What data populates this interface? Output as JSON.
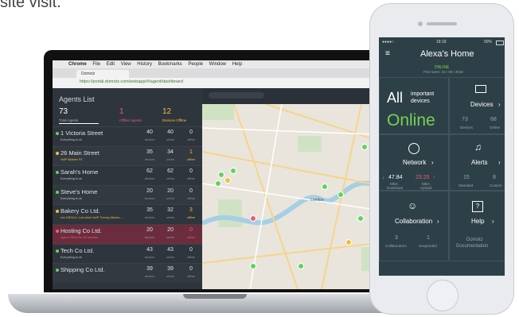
{
  "caption_fragment": "site visit.",
  "laptop": {
    "menu": {
      "app": "Chrome",
      "items": [
        "File",
        "Edit",
        "View",
        "History",
        "Bookmarks",
        "People",
        "Window",
        "Help"
      ]
    },
    "tab": "Domotz",
    "url": "https://portal.domotz.com/webapp/#/agent/dashboard",
    "title": "Agents List",
    "stats": [
      {
        "value": "73",
        "label": "Total Agents",
        "color": "#ffffff"
      },
      {
        "value": "1",
        "label": "Offline Agents",
        "color": "#ef5b7a"
      },
      {
        "value": "12",
        "label": "Devices Offline",
        "color": "#e8c23c"
      }
    ],
    "agents": [
      {
        "name": "1 Victoria Street",
        "sub": "Everything is ok",
        "dot": "#5fd35d",
        "devices": "40",
        "online": "40",
        "offline": "0",
        "offline_color": "#dfe3e7"
      },
      {
        "name": "26 Main Street",
        "sub": "VoIP Kitchen FX",
        "dot": "#f0c03a",
        "devices": "35",
        "online": "34",
        "offline": "1",
        "offline_color": "#f0c03a"
      },
      {
        "name": "Sarah's Home",
        "sub": "Everything is ok",
        "dot": "#5fd35d",
        "devices": "62",
        "online": "62",
        "offline": "0",
        "offline_color": "#dfe3e7"
      },
      {
        "name": "Steve's Home",
        "sub": "Everything is ok",
        "dot": "#5fd35d",
        "devices": "20",
        "online": "20",
        "offline": "0",
        "offline_color": "#dfe3e7"
      },
      {
        "name": "Bakery Co Ltd.",
        "sub": "cnx DSDULI, Luis desk VoIP, Tommy Macbo...",
        "dot": "#f0c03a",
        "devices": "35",
        "online": "32",
        "offline": "3",
        "offline_color": "#f0c03a"
      },
      {
        "name": "Hosting Co Ltd.",
        "sub": "Agent Offline for 35 minutes",
        "dot": "#ef5b7a",
        "devices": "20",
        "online": "20",
        "offline": "0",
        "offline_color": "#ef5b7a",
        "alert": true
      },
      {
        "name": "Tech Co Ltd.",
        "sub": "Everything is ok",
        "dot": "#5fd35d",
        "devices": "43",
        "online": "43",
        "offline": "0",
        "offline_color": "#dfe3e7"
      },
      {
        "name": "Shipping Co Ltd.",
        "sub": "",
        "dot": "#5fd35d",
        "devices": "39",
        "online": "39",
        "offline": "0",
        "offline_color": "#dfe3e7"
      }
    ],
    "col_labels": {
      "devices": "devices",
      "online": "online",
      "offline": "offline"
    },
    "map_label": "London"
  },
  "phone": {
    "time": "18:18",
    "battery": "90%",
    "title": "Alexa's Home",
    "status": "ONLINE",
    "first_seen": "First seen: 23 / 08 / 2016",
    "all": "All",
    "important": "important",
    "devices_word": "devices",
    "online": "Online",
    "devices_label": "Devices",
    "devices_count": "73",
    "devices_count_lbl": "Devices",
    "online_count": "68",
    "online_count_lbl": "Online",
    "network_label": "Network",
    "alerts_label": "Alerts",
    "download": "47.84",
    "download_unit": "Mb/s",
    "download_lbl": "Download",
    "upload": "23.25",
    "upload_unit": "Mb/s",
    "upload_lbl": "Upload",
    "standard": "15",
    "standard_lbl": "Standard",
    "custom": "8",
    "custom_lbl": "Custom",
    "collab_label": "Collaboration",
    "help_label": "Help",
    "collaborators": "3",
    "collaborators_lbl": "Collaborators",
    "suspended": "1",
    "suspended_lbl": "Suspended",
    "domotz": "Domotz",
    "documentation": "Documentation"
  }
}
